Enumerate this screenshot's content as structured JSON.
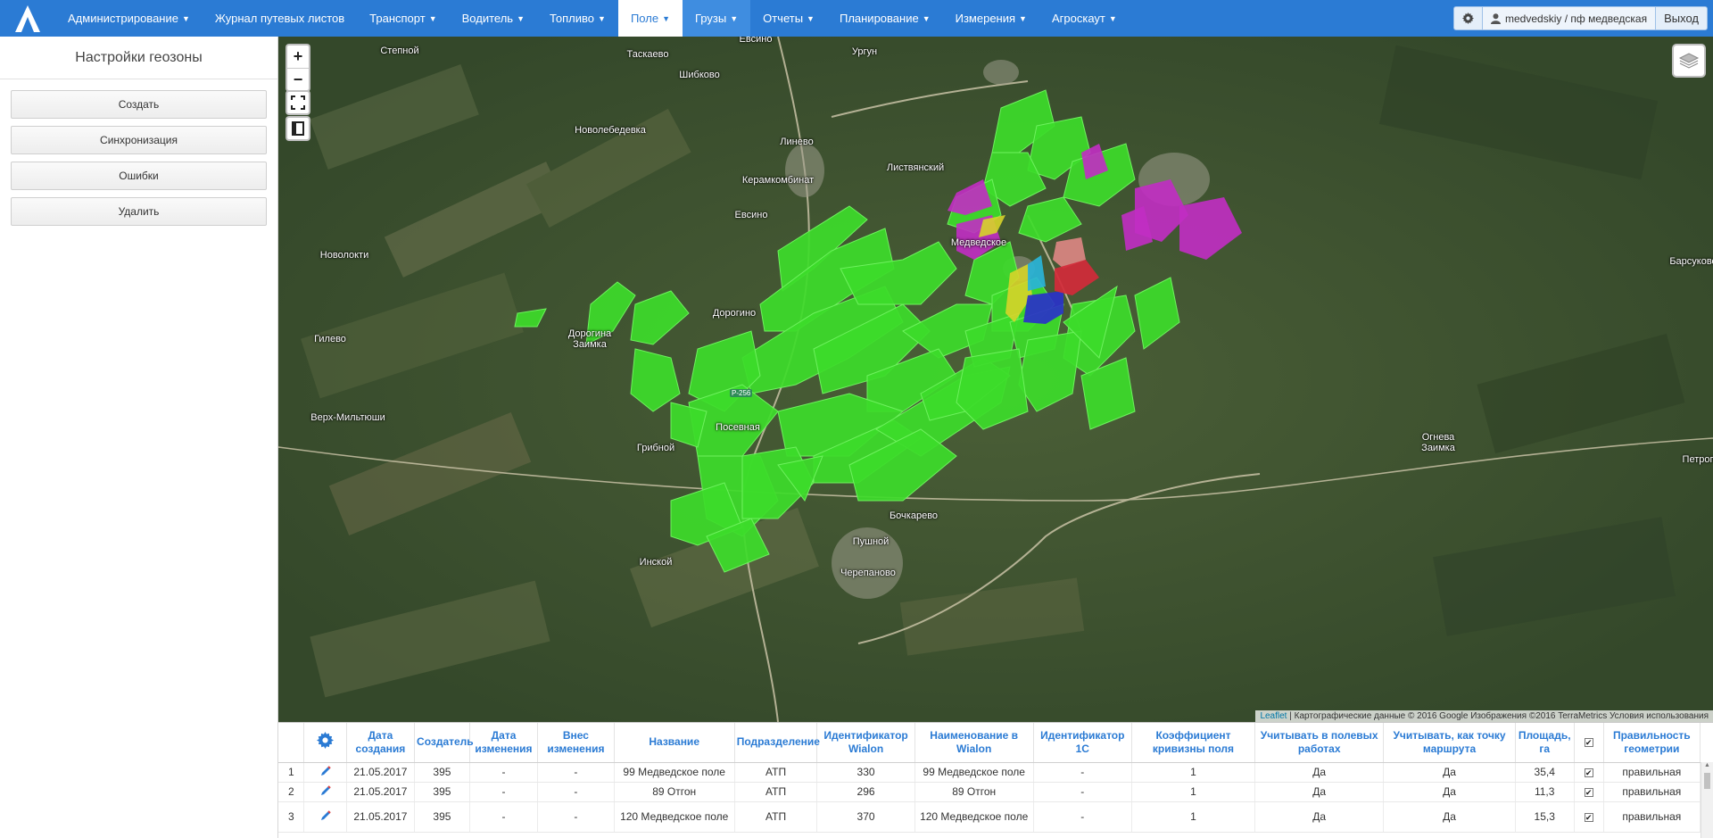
{
  "nav": {
    "items": [
      {
        "label": "Администрирование",
        "caret": true
      },
      {
        "label": "Журнал путевых листов",
        "caret": false
      },
      {
        "label": "Транспорт",
        "caret": true
      },
      {
        "label": "Водитель",
        "caret": true
      },
      {
        "label": "Топливо",
        "caret": true
      },
      {
        "label": "Поле",
        "caret": true
      },
      {
        "label": "Грузы",
        "caret": true
      },
      {
        "label": "Отчеты",
        "caret": true
      },
      {
        "label": "Планирование",
        "caret": true
      },
      {
        "label": "Измерения",
        "caret": true
      },
      {
        "label": "Агроскаут",
        "caret": true
      }
    ],
    "active_item": "Поле",
    "user": "medvedskiy / пф медведская",
    "logout": "Выход"
  },
  "left_panel": {
    "title": "Настройки геозоны",
    "buttons": [
      "Создать",
      "Синхронизация",
      "Ошибки",
      "Удалить"
    ]
  },
  "map": {
    "zoom_in": "+",
    "zoom_out": "−",
    "road_label": "Р-256",
    "attribution_link": "Leaflet",
    "attribution_text": " | Картографические данные © 2016 Google Изображения ©2016 TerraMetrics Условия использования",
    "places": [
      "Евсино",
      "Степной",
      "Таскаево",
      "Ургун",
      "Шибково",
      "Новолебедевка",
      "Линево",
      "Листвянский",
      "Керамкомбинат",
      "Евсино",
      "Медведское",
      "Новолокти",
      "Барсуково",
      "Дорогино",
      "Дорогина Заимка",
      "Гилево",
      "Верх-Мильтюши",
      "Посевная",
      "Грибной",
      "Огнева Заимка",
      "Петроп",
      "Бочкарево",
      "Пушной",
      "Инской",
      "Черепаново"
    ],
    "colors": {
      "fields_green": "#3ddc2a",
      "fields_magenta": "#c22ec4",
      "fields_yellow": "#d7d42a",
      "fields_blue": "#2a32c8",
      "fields_cyan": "#2ab4d8",
      "fields_red": "#d22a3a",
      "fields_pink": "#e88a8a"
    }
  },
  "table": {
    "headers": [
      "",
      "",
      "Дата создания",
      "Создатель",
      "Дата изменения",
      "Внес изменения",
      "Название",
      "Подразделение",
      "Идентификатор Wialon",
      "Наименование в Wialon",
      "Идентификатор 1С",
      "Коэффициент кривизны поля",
      "Учитывать в полевых работах",
      "Учитывать, как точку маршрута",
      "Площадь, га",
      "✔",
      "Правильность геометрии"
    ],
    "rows": [
      {
        "n": "1",
        "created": "21.05.2017",
        "creator": "395",
        "changed": "-",
        "changed_by": "-",
        "name": "99 Медведское поле",
        "unit": "АТП",
        "wialon_id": "330",
        "wialon_name": "99 Медведское поле",
        "id1c": "-",
        "coef": "1",
        "field_work": "Да",
        "route_point": "Да",
        "area": "35,4",
        "geom": "правильная"
      },
      {
        "n": "2",
        "created": "21.05.2017",
        "creator": "395",
        "changed": "-",
        "changed_by": "-",
        "name": "89 Отгон",
        "unit": "АТП",
        "wialon_id": "296",
        "wialon_name": "89 Отгон",
        "id1c": "-",
        "coef": "1",
        "field_work": "Да",
        "route_point": "Да",
        "area": "11,3",
        "geom": "правильная"
      },
      {
        "n": "3",
        "created": "21.05.2017",
        "creator": "395",
        "changed": "-",
        "changed_by": "-",
        "name": "120 Медведское поле",
        "unit": "АТП",
        "wialon_id": "370",
        "wialon_name": "120 Медведское поле",
        "id1c": "-",
        "coef": "1",
        "field_work": "Да",
        "route_point": "Да",
        "area": "15,3",
        "geom": "правильная"
      }
    ]
  }
}
